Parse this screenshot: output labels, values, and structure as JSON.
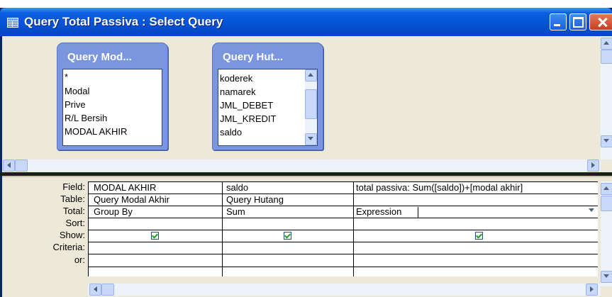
{
  "window": {
    "title": "Query Total Passiva : Select Query"
  },
  "field_lists": [
    {
      "title": "Query Mod...",
      "fields": [
        "*",
        "Modal",
        "Prive",
        "R/L Bersih",
        "MODAL AKHIR"
      ]
    },
    {
      "title": "Query Hut...",
      "fields": [
        "koderek",
        "namarek",
        "JML_DEBET",
        "JML_KREDIT",
        "saldo"
      ]
    }
  ],
  "grid": {
    "row_labels": [
      "Field:",
      "Table:",
      "Total:",
      "Sort:",
      "Show:",
      "Criteria:",
      "or:"
    ],
    "columns": [
      {
        "field": "MODAL AKHIR",
        "table": "Query Modal Akhir",
        "total": "Group By",
        "sort": "",
        "show": true,
        "criteria": "",
        "or": ""
      },
      {
        "field": "saldo",
        "table": "Query Hutang",
        "total": "Sum",
        "sort": "",
        "show": true,
        "criteria": "",
        "or": ""
      },
      {
        "field": "total passiva: Sum([saldo])+[modal akhir]",
        "table": "",
        "total": "Expression",
        "sort": "",
        "show": true,
        "criteria": "",
        "or": ""
      }
    ]
  },
  "colors": {
    "titlebar": "#0553d6",
    "field_list": "#7a96df",
    "background": "#ece9d8",
    "checkmark": "#21a121"
  }
}
